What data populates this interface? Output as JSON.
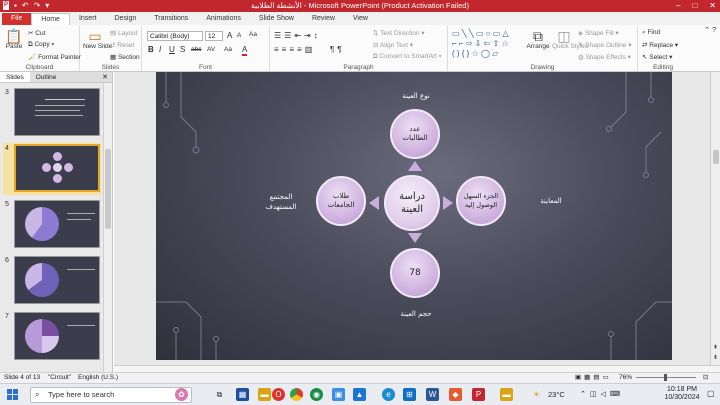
{
  "titlebar": {
    "title": "الأنشطة الطلابية - Microsoft PowerPoint (Product Activation Failed)",
    "qat_icons": [
      "ppt-logo-icon",
      "save-icon",
      "undo-icon",
      "redo-icon",
      "customize-icon"
    ],
    "minimize": "–",
    "maximize": "□",
    "close": "✕"
  },
  "tabs": [
    "File",
    "Home",
    "Insert",
    "Design",
    "Transitions",
    "Animations",
    "Slide Show",
    "Review",
    "View"
  ],
  "ribbon": {
    "clipboard": {
      "paste": "Paste",
      "cut": "Cut",
      "copy": "Copy",
      "format_painter": "Format Painter",
      "label": "Clipboard"
    },
    "slides": {
      "new_slide": "New Slide",
      "layout": "Layout",
      "reset": "Reset",
      "section": "Section",
      "label": "Slides"
    },
    "font": {
      "font_name": "Calibri (Body)",
      "font_size": "12",
      "grow": "A",
      "shrink": "A",
      "clear": "Aa",
      "bold": "B",
      "italic": "I",
      "underline": "U",
      "shadow": "S",
      "strike": "abc",
      "spacing": "AV",
      "case": "Aa",
      "color": "A",
      "label": "Font"
    },
    "paragraph": {
      "text_direction": "Text Direction",
      "align_text": "Align Text",
      "smartart": "Convert to SmartArt",
      "label": "Paragraph"
    },
    "drawing": {
      "arrange": "Arrange",
      "quick_styles": "Quick Styles",
      "shape_fill": "Shape Fill",
      "shape_outline": "Shape Outline",
      "shape_effects": "Shape Effects",
      "label": "Drawing"
    },
    "editing": {
      "find": "Find",
      "replace": "Replace",
      "select": "Select",
      "label": "Editing"
    }
  },
  "left_pane": {
    "tabs": [
      "Slides",
      "Outline"
    ],
    "close": "✕",
    "thumbnails": [
      {
        "num": "3",
        "kind": "text"
      },
      {
        "num": "4",
        "kind": "diagram",
        "selected": true
      },
      {
        "num": "5",
        "kind": "pie"
      },
      {
        "num": "6",
        "kind": "pie"
      },
      {
        "num": "7",
        "kind": "pie2"
      }
    ]
  },
  "slide": {
    "center": "دراسة العينة",
    "top_circle": "عدد الطالبات",
    "left_circle": "طلاب الجامعات",
    "right_circle": "الجزء السهل الوصول إليه",
    "bottom_circle": "78",
    "label_top": "نوع العينة",
    "label_left": "المجتمع المستهدف",
    "label_right": "المعاينة",
    "label_bottom": "حجم العينة"
  },
  "statusbar": {
    "slide_info": "Slide 4 of 13",
    "theme": "\"Circuit\"",
    "language": "English (U.S.)",
    "zoom": "76%"
  },
  "taskbar": {
    "search_placeholder": "Type here to search",
    "weather": "23°C",
    "time": "10:18 PM",
    "date": "10/30/2024"
  }
}
